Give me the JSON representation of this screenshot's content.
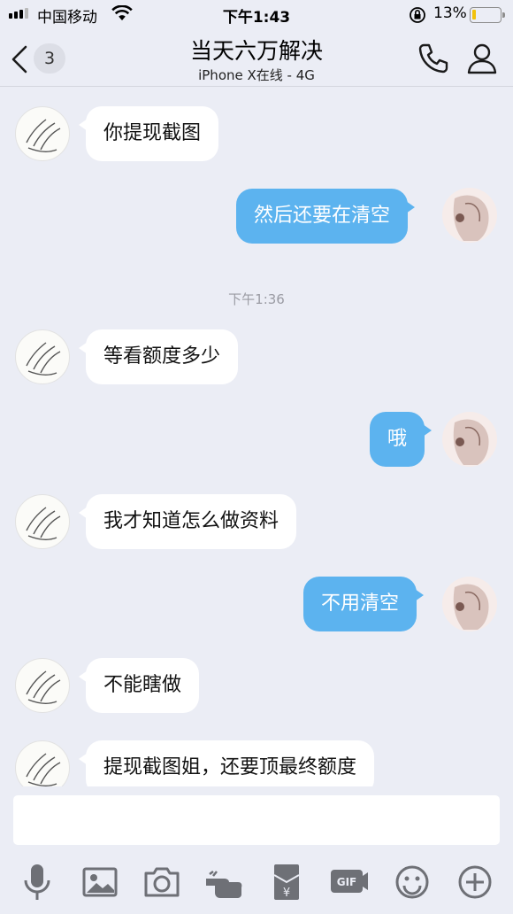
{
  "status_bar": {
    "carrier": "中国移动",
    "time": "下午1:43",
    "battery_percent": "13%",
    "battery_level": 0.13,
    "battery_color": "#f2c20b"
  },
  "nav": {
    "back_icon": "chevron-left-icon",
    "unread_count": "3",
    "title": "当天六万解决",
    "subtitle": "iPhone X在线 - 4G",
    "call_icon": "phone-icon",
    "profile_icon": "person-icon"
  },
  "messages": [
    {
      "side": "in",
      "text": "你提现截图"
    },
    {
      "side": "out",
      "text": "然后还要在清空"
    },
    {
      "side": "in",
      "text": "等看额度多少"
    },
    {
      "side": "out",
      "text": "哦"
    },
    {
      "side": "in",
      "text": "我才知道怎么做资料"
    },
    {
      "side": "out",
      "text": "不用清空"
    },
    {
      "side": "in",
      "text": "不能瞎做"
    },
    {
      "side": "in",
      "text": "提现截图姐，还要顶最终额度"
    }
  ],
  "time_divider": "下午1:36",
  "input": {
    "value": "",
    "placeholder": ""
  },
  "toolbar": [
    "microphone-icon",
    "image-icon",
    "camera-icon",
    "poke-hand-icon",
    "red-packet-icon",
    "gif-icon",
    "emoji-icon",
    "plus-icon"
  ],
  "colors": {
    "background": "#ebedf5",
    "outgoing_bubble": "#5cb3ef",
    "incoming_bubble": "#ffffff"
  }
}
